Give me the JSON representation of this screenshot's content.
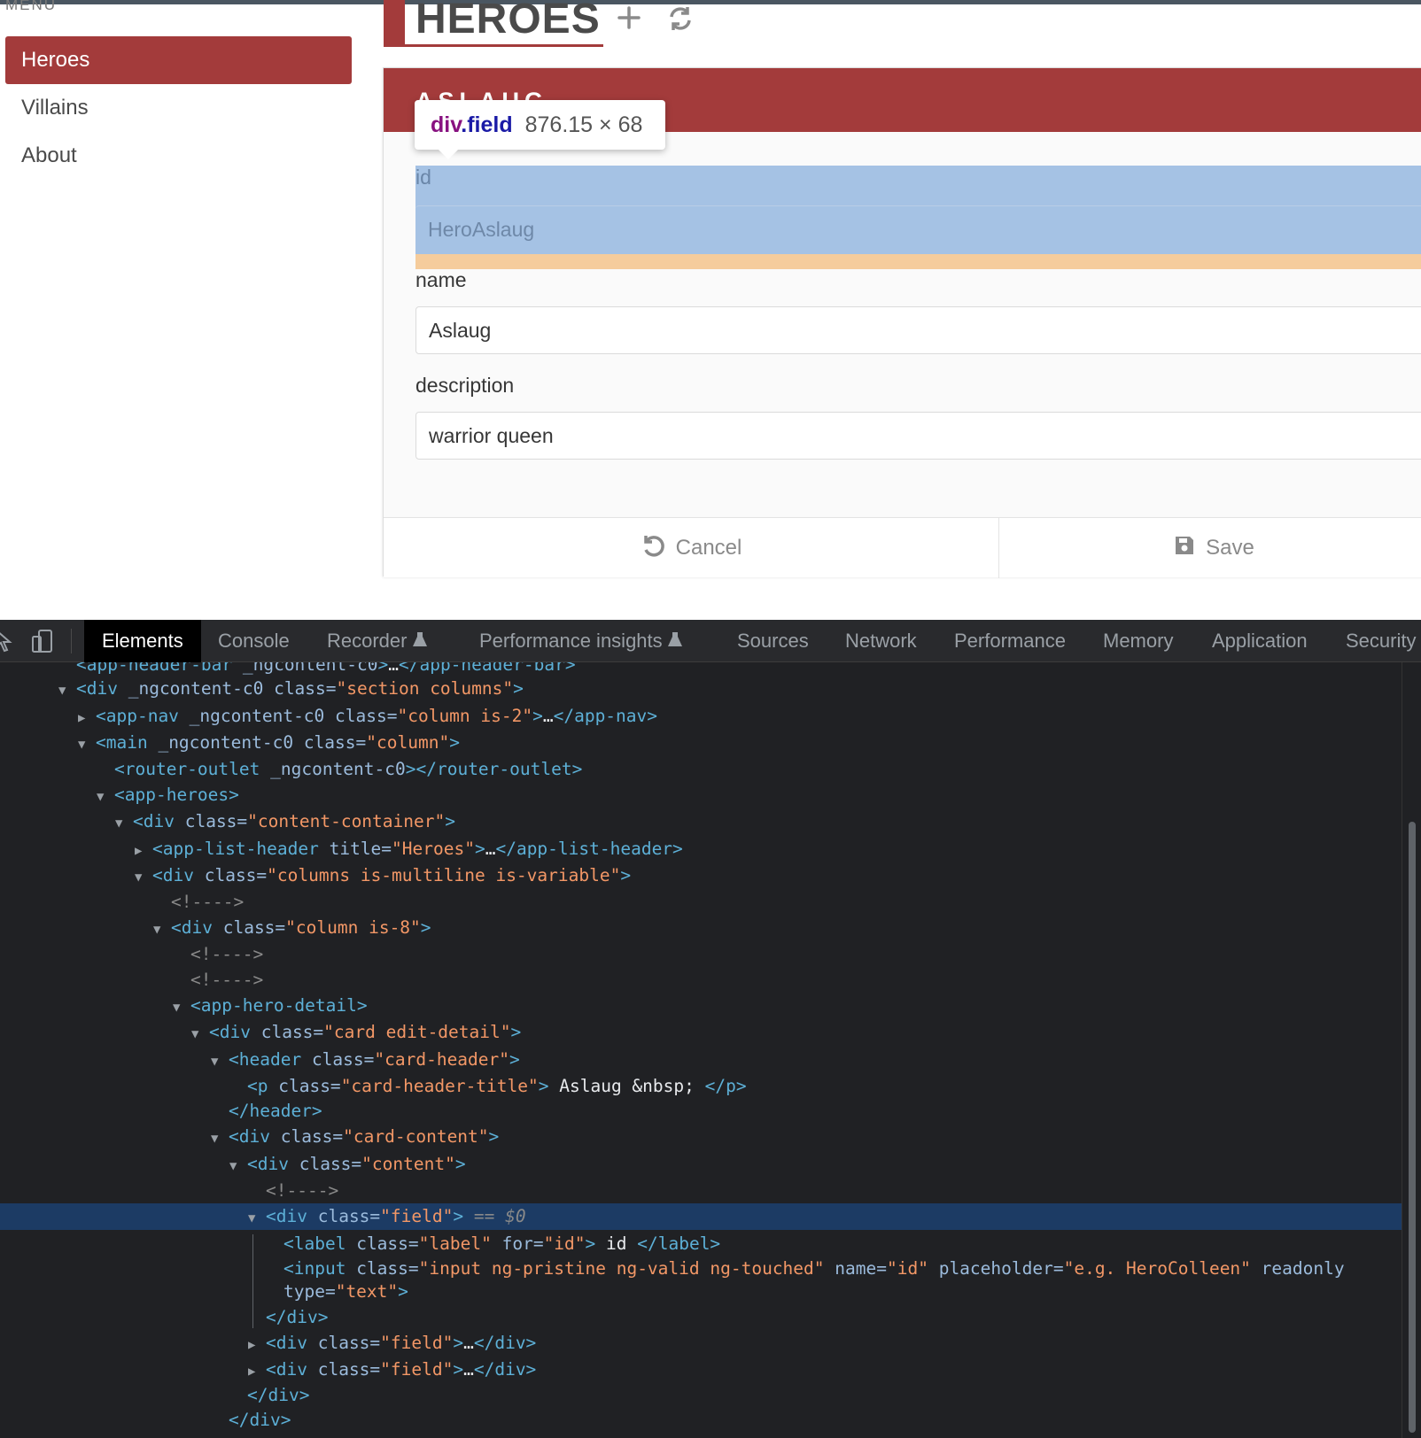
{
  "nav": {
    "menu_label": "MENU",
    "items": [
      {
        "label": "Heroes",
        "active": true
      },
      {
        "label": "Villains",
        "active": false
      },
      {
        "label": "About",
        "active": false
      }
    ]
  },
  "list_header": {
    "title": "HEROES",
    "add_icon": "plus-icon",
    "refresh_icon": "refresh-icon"
  },
  "card": {
    "header_title": "Aslaug",
    "fields": {
      "id": {
        "label": "id",
        "value": "HeroAslaug"
      },
      "name": {
        "label": "name",
        "value": "Aslaug"
      },
      "description": {
        "label": "description",
        "value": "warrior queen"
      }
    },
    "cancel_label": "Cancel",
    "save_label": "Save"
  },
  "tooltip": {
    "tag": "div",
    "class": ".field",
    "size": "876.15 × 68"
  },
  "devtools": {
    "tabs": [
      "Elements",
      "Console",
      "Recorder",
      "Performance insights",
      "Sources",
      "Network",
      "Performance",
      "Memory",
      "Application",
      "Security"
    ],
    "active_tab": "Elements"
  },
  "colors": {
    "accent": "#a33b3b",
    "highlight_content": "#a5c2e4",
    "highlight_margin": "#f5cc9c",
    "devtools_bg": "#202124",
    "selected_row": "#1c3b64"
  }
}
